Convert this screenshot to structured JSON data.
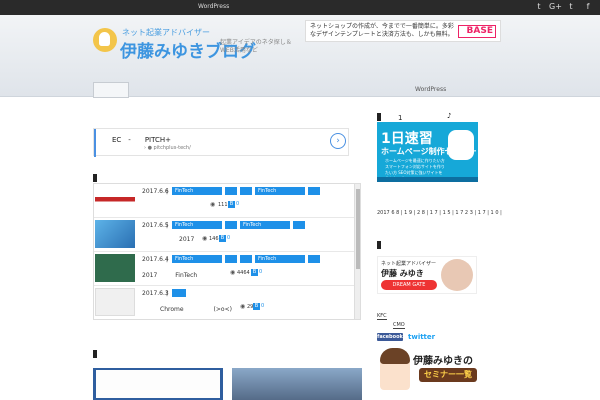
{
  "topbar": {
    "link_label": "WordPress",
    "social": [
      {
        "icon": "twitter-icon",
        "glyph": "t"
      },
      {
        "icon": "googleplus-icon",
        "glyph": "G+"
      },
      {
        "icon": "twitter-bird-icon",
        "glyph": "t"
      },
      {
        "icon": "facebook-icon",
        "glyph": "f"
      }
    ]
  },
  "header": {
    "tagline": "ネット起業アドバイザー",
    "site_title": "伊藤みゆきブログ",
    "site_desc": "起業アイデアのネタ探し＆WEB活用など",
    "banner_text": "ネットショップの作成が、今までで一番簡単に。多彩なデザインテンプレートと決済方法も、しかも無料。",
    "banner_logo": "BASE"
  },
  "nav": {
    "items": [
      {
        "label": "WordPress"
      }
    ]
  },
  "ad": {
    "title": "EC　-　　PITCH+",
    "sub": "› ●  pitchplus-tech/"
  },
  "posts": [
    {
      "date": "2017.6.6",
      "sep": "|",
      "tags": [
        "FinTech",
        "",
        "",
        "FinTech",
        ""
      ],
      "excerpt": "",
      "views": "111",
      "badge": "B",
      "badge_text": "0"
    },
    {
      "date": "2017.6.5",
      "sep": "|",
      "tags": [
        "FinTech",
        "",
        "FinTech",
        ""
      ],
      "excerpt": "2017",
      "views": "146",
      "badge": "B",
      "badge_text": "0"
    },
    {
      "date": "2017.6.4",
      "sep": "|",
      "tags": [
        "FinTech",
        "",
        "",
        "FinTech",
        ""
      ],
      "excerpt": "2017　　　FinTech",
      "views": "4464",
      "badge": "B",
      "badge_text": "0"
    },
    {
      "date": "2017.6.3",
      "sep": "|",
      "tags": [
        ""
      ],
      "excerpt": "Chrome　　　　　(>o<)",
      "views": "29",
      "badge": "B",
      "badge_text": "0"
    }
  ],
  "sidebar": {
    "head_num": "1",
    "note": "♪",
    "banner1": {
      "big": "1日速習",
      "title": "ホームページ制作セミナー",
      "lines": "ホームページを最速に作りたい方 スマートフォン対応サイトを作りたい方 SEO対策に強いサイトを作りたい方"
    },
    "archive": "2017 6 8 | 1 9 | 2 8 | 1 7 | 1 5 | 1 7 2 3 | 1 7 | 1 0 |",
    "banner2": {
      "small": "ネット起業アドバイザー",
      "name": "伊藤 みゆき",
      "btn": "DREAM GATE"
    },
    "links": [
      {
        "label": "KFC"
      },
      {
        "label": "CMO"
      }
    ],
    "facebook": "facebook",
    "twitter": "twitter",
    "banner3": {
      "title": "伊藤みゆきの",
      "sub": "セミナー一覧"
    }
  }
}
